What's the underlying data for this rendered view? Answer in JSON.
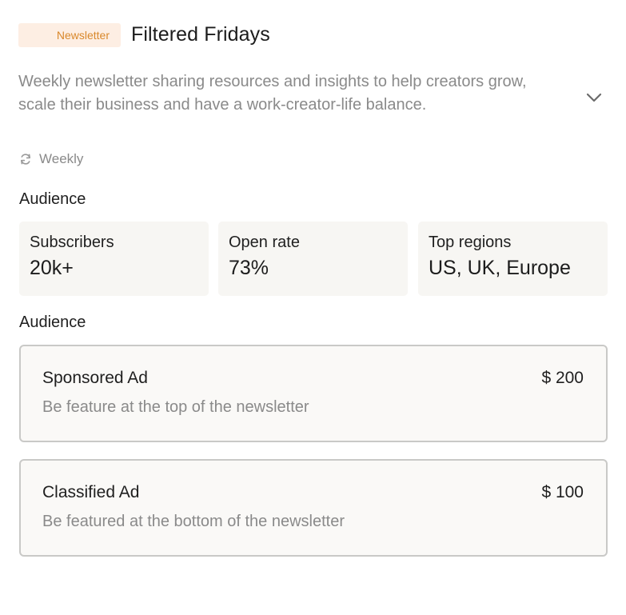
{
  "newsletter": {
    "badge": "Newsletter",
    "title": "Filtered Fridays",
    "description": "Weekly newsletter sharing resources and insights to help creators grow, scale their business and have a work-creator-life balance.",
    "frequency": "Weekly",
    "frequency_icon": "refresh-icon",
    "expand_icon": "chevron-down-icon"
  },
  "audience": {
    "label": "Audience",
    "stats": [
      {
        "label": "Subscribers",
        "value": "20k+"
      },
      {
        "label": "Open rate",
        "value": "73%"
      },
      {
        "label": "Top regions",
        "value": "US, UK, Europe"
      }
    ]
  },
  "ads": {
    "label": "Audience",
    "options": [
      {
        "name": "Sponsored Ad",
        "price": "$ 200",
        "description": "Be feature at the top of the newsletter"
      },
      {
        "name": "Classified Ad",
        "price": "$ 100",
        "description": "Be featured at the bottom of the newsletter"
      }
    ]
  },
  "colors": {
    "badge_bg": "#fdeee3",
    "badge_text": "#d9882b",
    "stat_bg": "#f7f6f3",
    "option_border": "#c9c9c7",
    "muted_text": "#8a8a8a"
  }
}
